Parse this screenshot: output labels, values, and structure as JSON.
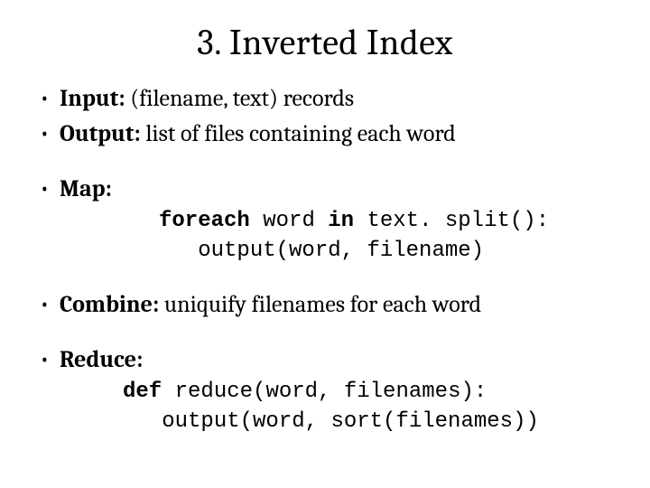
{
  "title": "3. Inverted Index",
  "bullets": {
    "input": {
      "label": "Input:",
      "text": " (filename, text) records"
    },
    "output": {
      "label": "Output:",
      "text": " list of files containing each word"
    },
    "map": {
      "label": "Map:"
    },
    "combine": {
      "label": "Combine:",
      "text": " uniquify filenames for each word"
    },
    "reduce": {
      "label": "Reduce:"
    }
  },
  "code": {
    "map_line1_a": "foreach",
    "map_line1_b": " word ",
    "map_line1_c": "in",
    "map_line1_d": " text. split():",
    "map_line2": "   output(word, filename)",
    "reduce_line1_a": "def",
    "reduce_line1_b": " reduce(word, filenames):",
    "reduce_line2": "   output(word, sort(filenames))"
  }
}
